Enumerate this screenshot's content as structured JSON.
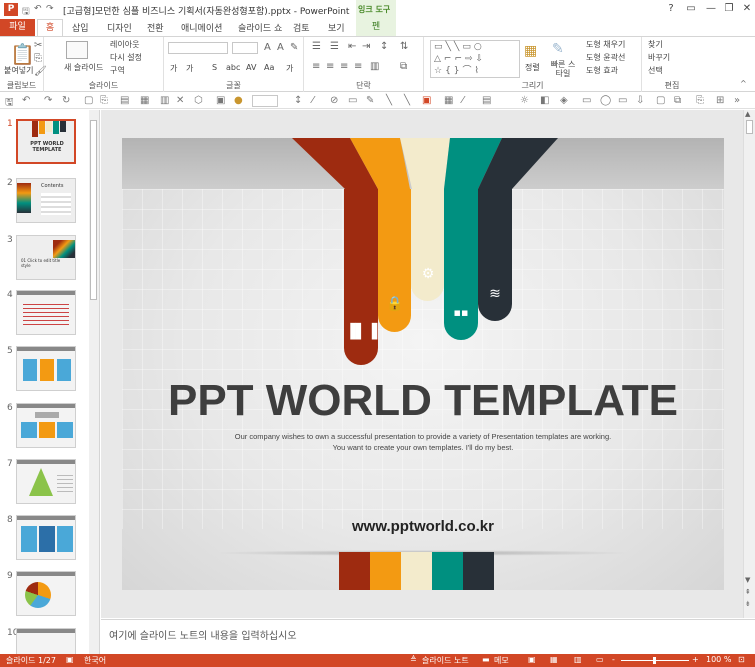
{
  "window": {
    "title": "[고급형]모던한 심플 비즈니스 기획서(자동완성형포함).pptx - PowerPoint",
    "app_badge": "P",
    "context_group": "잉크 도구",
    "controls": [
      "?",
      "▭",
      "—",
      "❐",
      "✕"
    ]
  },
  "tabs": {
    "file": "파일",
    "items": [
      "홈",
      "삽입",
      "디자인",
      "전환",
      "애니메이션",
      "슬라이드 쇼",
      "검토",
      "보기"
    ],
    "active": "홈",
    "pen": "펜"
  },
  "ribbon": {
    "clipboard": {
      "paste": "붙여넣기",
      "label": "클립보드"
    },
    "slides": {
      "new_slide": "새 슬라이드",
      "layout": "레이아웃",
      "reset": "다시 설정",
      "section": "구역",
      "label": "슬라이드"
    },
    "font": {
      "label": "글꼴",
      "effects": [
        "가",
        "가",
        "S",
        "abc",
        "AV",
        "Aa",
        "가"
      ]
    },
    "paragraph": {
      "label": "단락"
    },
    "drawing": {
      "arrange": "정렬",
      "quick_styles": "빠른 스타일",
      "fill": "도형 채우기",
      "outline": "도형 윤곽선",
      "effects": "도형 효과",
      "label": "그리기"
    },
    "editing": {
      "find": "찾기",
      "replace": "바꾸기",
      "select": "선택",
      "label": "편집"
    }
  },
  "thumbnails": {
    "numbers": [
      "1",
      "2",
      "3",
      "4",
      "5",
      "6",
      "7",
      "8",
      "9",
      "10"
    ],
    "selected": 1,
    "slide1_title": "PPT WORLD TEMPLATE",
    "slide2_title": "Contents",
    "slide3_title": "01 Click to edit title style"
  },
  "slide": {
    "title": "PPT WORLD TEMPLATE",
    "subtitle_line1": "Our company wishes to own a successful presentation to provide a variety of Presentation templates are working.",
    "subtitle_line2": "You want to create your own templates. I'll do my best.",
    "url": "www.pptworld.co.kr",
    "colors": [
      "#9e2b10",
      "#f39a12",
      "#f3ebcc",
      "#009080",
      "#283038"
    ],
    "icons": [
      "bar-chart-icon",
      "lock-icon",
      "gears-icon",
      "signal-icon",
      "wifi-icon"
    ]
  },
  "notes": {
    "placeholder": "여기에 슬라이드 노트의 내용을 입력하십시오"
  },
  "status": {
    "slide_counter": "슬라이드 1/27",
    "language": "한국어",
    "notes": "슬라이드 노트",
    "comments": "메모",
    "zoom_minus": "-",
    "zoom_plus": "+",
    "zoom": "100 %"
  }
}
